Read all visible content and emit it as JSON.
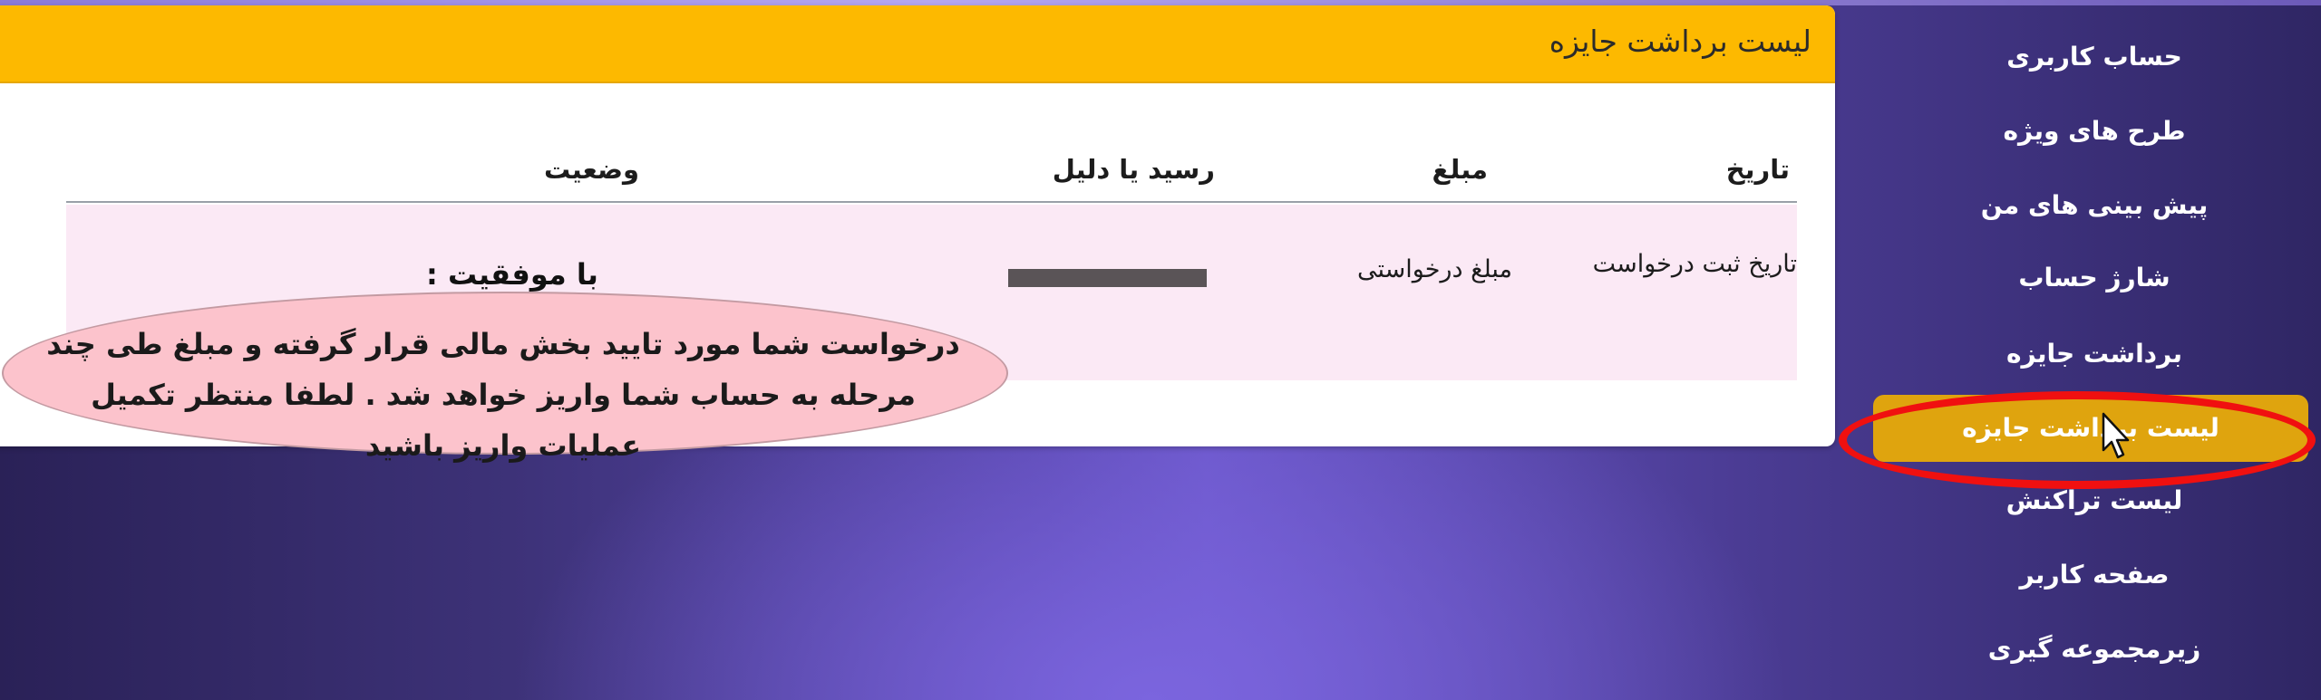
{
  "panel": {
    "title": "لیست برداشت جایزه"
  },
  "table": {
    "headers": {
      "date": "تاریخ",
      "amount": "مبلغ",
      "receipt": "رسید یا دلیل",
      "status": "وضعیت"
    },
    "row": {
      "date": "تاریخ ثبت درخواست",
      "amount": "مبلغ  درخواستی",
      "status_label": "با موفقیت :",
      "status_message": "درخواست شما مورد تایید بخش مالی قرار گرفته و مبلغ طی چند مرحله به حساب شما واریز خواهد شد . لطفا منتظر تکمیل عملیات واریز باشید"
    }
  },
  "sidebar": {
    "items": [
      {
        "label": "حساب کاربری"
      },
      {
        "label": "طرح های ویژه"
      },
      {
        "label": "پیش بینی های من"
      },
      {
        "label": "شارژ حساب"
      },
      {
        "label": "برداشت جایزه"
      },
      {
        "label": "لیست برداشت جایزه",
        "active": true
      },
      {
        "label": "لیست تراکنش"
      },
      {
        "label": "صفحه کاربر"
      },
      {
        "label": "زیرمجموعه گیری"
      }
    ]
  },
  "colors": {
    "header_accent": "#fdb900",
    "active_item": "#dfa40e",
    "highlight_ring": "#f01010",
    "row_background": "#fbe9f5",
    "note_background": "#fcc3cc"
  }
}
